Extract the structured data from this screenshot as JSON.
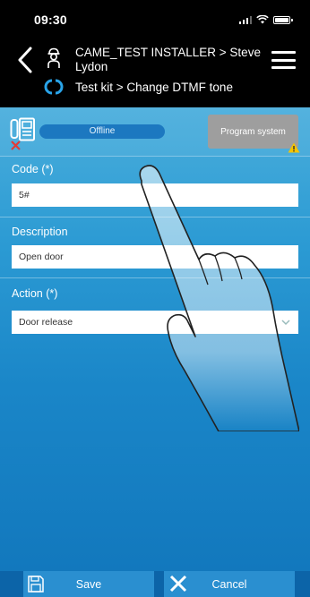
{
  "status_bar": {
    "time": "09:30"
  },
  "header": {
    "title": "CAME_TEST INSTALLER > Steve Lydon",
    "subtitle": "Test kit > Change DTMF tone"
  },
  "connection": {
    "status": "Offline",
    "program_button": "Program system"
  },
  "form": {
    "code": {
      "label": "Code (*)",
      "value": "5#"
    },
    "description": {
      "label": "Description",
      "value": "Open door"
    },
    "action": {
      "label": "Action (*)",
      "value": "Door release"
    }
  },
  "footer": {
    "save_label": "Save",
    "cancel_label": "Cancel"
  },
  "colors": {
    "accent": "#2b9ad3",
    "header_bg": "#000000",
    "program_button_bg": "#9e9e9e",
    "error": "#e53935",
    "warning": "#f5c400"
  },
  "icons": [
    "back-icon",
    "installer-icon",
    "menu-icon",
    "system-icon",
    "device-offline-icon",
    "warning-icon",
    "chevron-down-icon",
    "save-icon",
    "close-icon",
    "pointing-hand-icon"
  ]
}
